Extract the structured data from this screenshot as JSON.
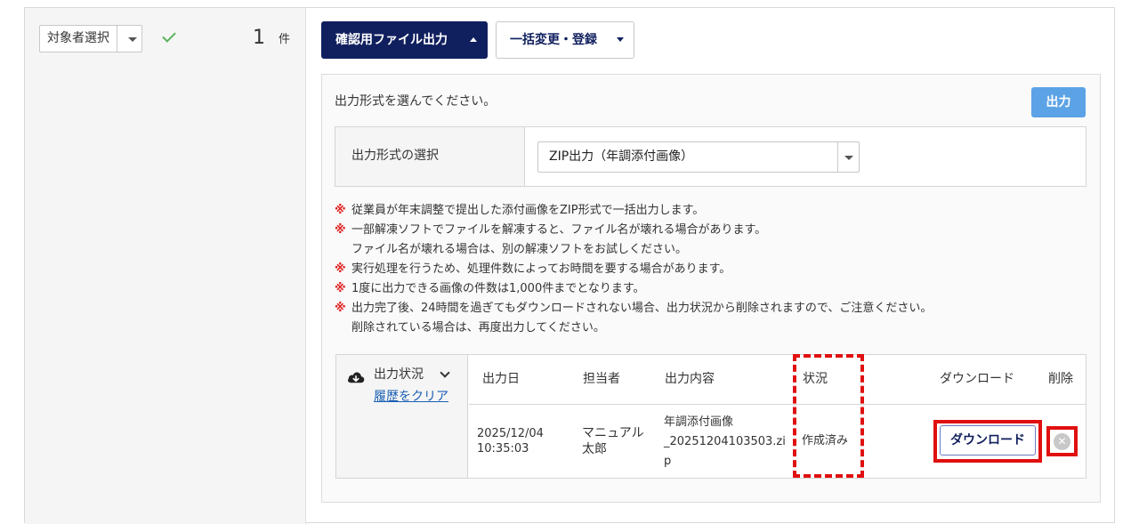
{
  "target_select": {
    "label": "対象者選択"
  },
  "count": {
    "value": "1",
    "unit": "件"
  },
  "toolbar": {
    "confirm_file_output": "確認用ファイル出力",
    "bulk_change_register": "一括変更・登録"
  },
  "output_panel": {
    "prompt": "出力形式を選んでください。",
    "output_button": "出力",
    "format_label": "出力形式の選択",
    "format_value": "ZIP出力（年調添付画像）"
  },
  "notes": [
    {
      "mark": "※",
      "lines": [
        "従業員が年末調整で提出した添付画像をZIP形式で一括出力します。"
      ]
    },
    {
      "mark": "※",
      "lines": [
        "一部解凍ソフトでファイルを解凍すると、ファイル名が壊れる場合があります。",
        "ファイル名が壊れる場合は、別の解凍ソフトをお試しください。"
      ]
    },
    {
      "mark": "※",
      "lines": [
        "実行処理を行うため、処理件数によってお時間を要する場合があります。"
      ]
    },
    {
      "mark": "※",
      "lines": [
        "1度に出力できる画像の件数は1,000件までとなります。"
      ]
    },
    {
      "mark": "※",
      "lines": [
        "出力完了後、24時間を過ぎてもダウンロードされない場合、出力状況から削除されますので、ご注意ください。",
        "削除されている場合は、再度出力してください。"
      ]
    }
  ],
  "output_status": {
    "title": "出力状況",
    "clear_history": "履歴をクリア",
    "headers": {
      "date": "出力日",
      "person": "担当者",
      "content": "出力内容",
      "status": "状況",
      "download": "ダウンロード",
      "delete": "削除"
    },
    "row": {
      "date_line1": "2025/12/04",
      "date_line2": "10:35:03",
      "person_line1": "マニュアル",
      "person_line2": "太郎",
      "content_line1": "年調添付画像",
      "content_line2": "_20251204103503.zi",
      "content_line3": "p",
      "status": "作成済み",
      "download_button": "ダウンロード",
      "delete_icon": "✕"
    }
  },
  "colors": {
    "navy": "#101f5e",
    "accent_blue": "#5ba3e6",
    "highlight_red": "#e01010",
    "check_green": "#59b25b"
  }
}
